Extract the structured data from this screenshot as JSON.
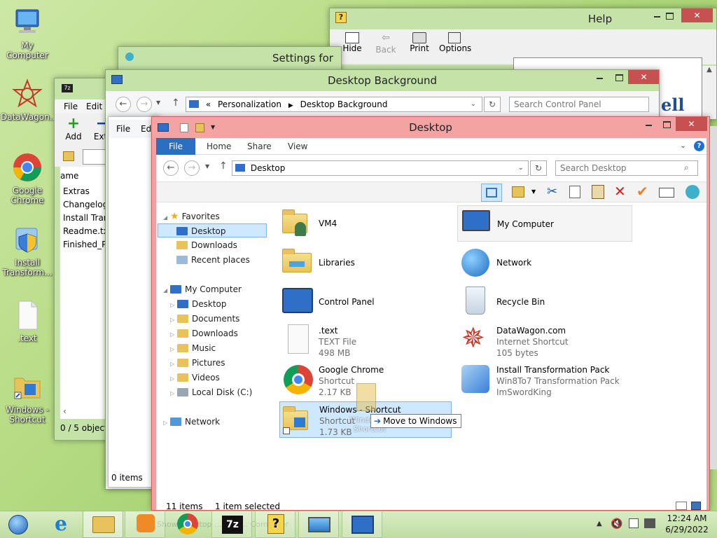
{
  "desktop": {
    "icons": [
      {
        "label": "My Computer"
      },
      {
        "label": "DataWagon..."
      },
      {
        "label": "Google Chrome"
      },
      {
        "label": "Install Transform..."
      },
      {
        "label": ".text"
      },
      {
        "label": "Windows - Shortcut"
      }
    ]
  },
  "help_window": {
    "title": "Help",
    "toolbar": {
      "hide": "Hide",
      "back": "Back",
      "print": "Print",
      "options": "Options"
    },
    "content_fragment": "ell"
  },
  "settings_window": {
    "title": "Settings for"
  },
  "zip_window": {
    "menu": {
      "file": "File",
      "edit": "Edit"
    },
    "toolbar": {
      "add": "Add",
      "extract": "Extr"
    },
    "col_name": "ame",
    "files": [
      "Extras",
      "Changelog",
      "Install Tran",
      "Readme.txt",
      "Finished_Pr"
    ],
    "status": "0 / 5 object("
  },
  "bg_window": {
    "title": "Desktop Background",
    "breadcrumb_prefix": "«",
    "breadcrumb": [
      "Personalization",
      "Desktop Background"
    ],
    "search_placeholder": "Search Control Panel"
  },
  "partial_window": {
    "menu_file": "File",
    "menu_edit": "Edi",
    "status": "0 items"
  },
  "explorer": {
    "title": "Desktop",
    "tabs": {
      "file": "File",
      "home": "Home",
      "share": "Share",
      "view": "View"
    },
    "address": "Desktop",
    "search_placeholder": "Search Desktop",
    "nav": {
      "favorites": "Favorites",
      "fav_items": [
        "Desktop",
        "Downloads",
        "Recent places"
      ],
      "computer": "My Computer",
      "computer_items": [
        "Desktop",
        "Documents",
        "Downloads",
        "Music",
        "Pictures",
        "Videos",
        "Local Disk (C:)"
      ],
      "network": "Network"
    },
    "items": {
      "vm4": {
        "name": "VM4"
      },
      "mycomputer": {
        "name": "My Computer"
      },
      "libraries": {
        "name": "Libraries"
      },
      "network": {
        "name": "Network"
      },
      "controlpanel": {
        "name": "Control Panel"
      },
      "recycle": {
        "name": "Recycle Bin"
      },
      "text": {
        "name": ".text",
        "type": "TEXT File",
        "size": "498 MB"
      },
      "datawagon": {
        "name": "DataWagon.com",
        "type": "Internet Shortcut",
        "size": "105 bytes"
      },
      "chrome": {
        "name": "Google Chrome",
        "type": "Shortcut",
        "size": "2.17 KB"
      },
      "install": {
        "name": "Install Transformation Pack",
        "type": "Win8To7 Transformation Pack",
        "size": "ImSwordKing"
      },
      "windows": {
        "name": "Windows - Shortcut",
        "type": "Shortcut",
        "size": "1.73 KB"
      }
    },
    "drag_tooltip": "Move to Windows",
    "drag_ghost_label": "Windows - Shortcut",
    "status_count": "11 items",
    "status_selected": "1 item selected"
  },
  "taskbar": {
    "time": "12:24 AM",
    "date": "6/29/2022",
    "ghost_text": "Show Desktop ... this ... Computer"
  },
  "colors": {
    "accent_file_tab": "#2b6ec2",
    "selection": "#cde8ff",
    "close_red": "#c75050"
  }
}
